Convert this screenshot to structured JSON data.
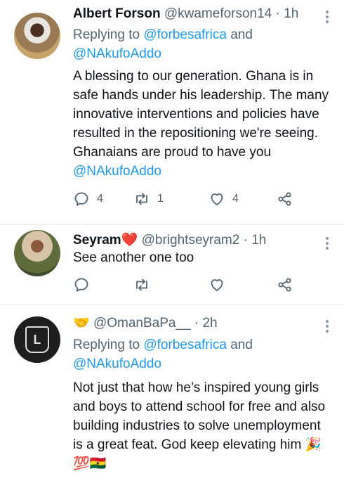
{
  "tweets": [
    {
      "name": "Albert Forson",
      "handle": "@kwameforson14",
      "time": "1h",
      "replying_label": "Replying to",
      "replying_to_1": "@forbesafrica",
      "and": "and",
      "replying_to_2": "@NAkufoAddo",
      "text": "A blessing to our generation. Ghana is in safe hands under his leadership. The many innovative interventions and policies have resulted in the repositioning we're seeing. Ghanaians are proud to have you ",
      "text_mention": "@NAkufoAddo",
      "replies": "4",
      "retweets": "1",
      "likes": "4"
    },
    {
      "name": "Seyram",
      "name_emoji": "❤️",
      "handle": "@brightseyram2",
      "time": "1h",
      "text": "See another one too"
    },
    {
      "name_emoji": "🤝",
      "handle": "@OmanBaPa__",
      "time": "2h",
      "replying_label": "Replying to",
      "replying_to_1": "@forbesafrica",
      "and": "and",
      "replying_to_2": "@NAkufoAddo",
      "text": "Not just that how he’s inspired young girls and boys to attend school for free and also building industries to solve unemployment is a great feat. God keep elevating him 🎉💯🇬🇭"
    }
  ],
  "icons": [
    "reply-icon",
    "retweet-icon",
    "like-icon",
    "share-icon",
    "more-options-icon"
  ],
  "colors": {
    "link": "#1d9bf0",
    "secondary_text": "#536471",
    "divider": "#e6ecf0"
  }
}
